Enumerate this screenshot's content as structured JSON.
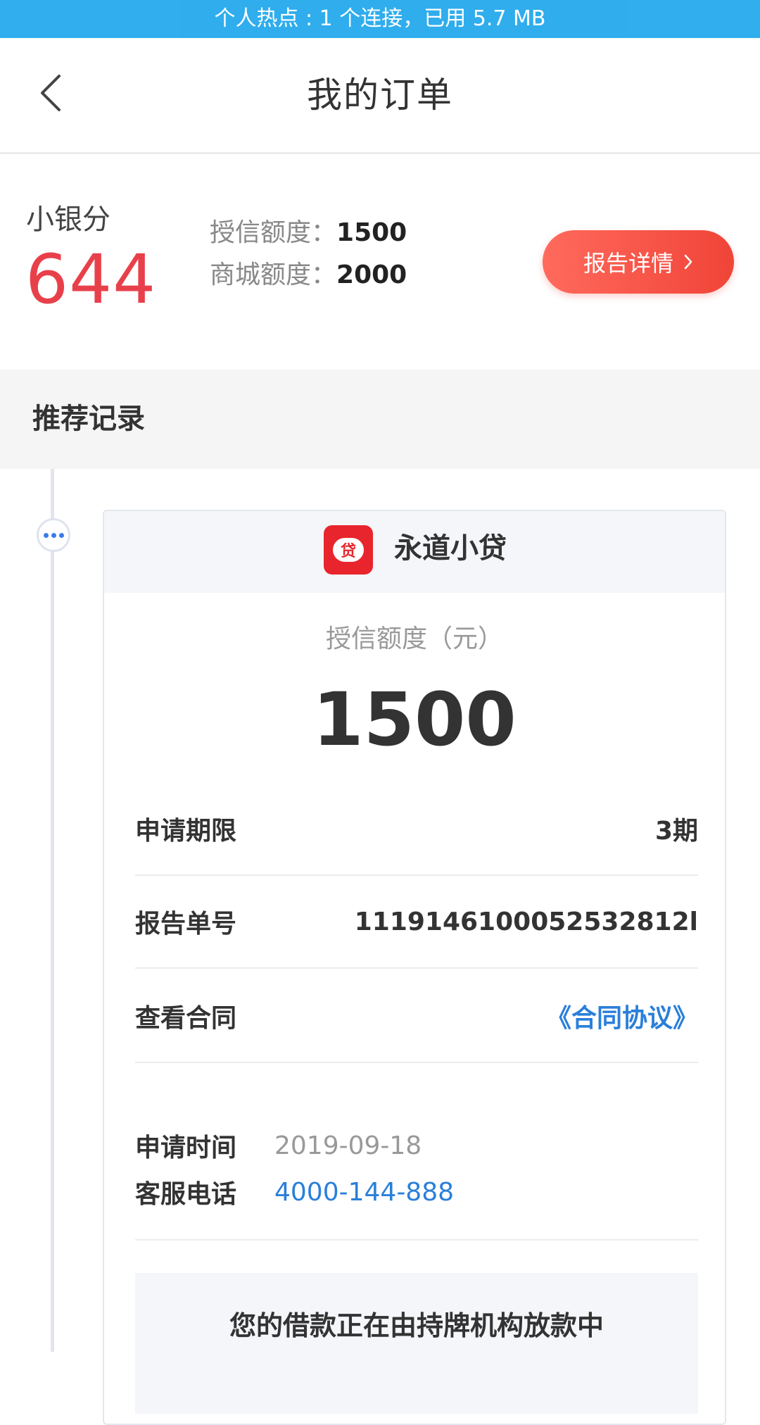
{
  "status_bar": {
    "text": "个人热点 : 1 个连接，已用 5.7 MB"
  },
  "nav": {
    "back_icon": "chevron-left-icon",
    "title": "我的订单"
  },
  "score": {
    "label": "小银分",
    "value": "644",
    "credit_label": "授信额度：",
    "credit_value": "1500",
    "mall_label": "商城额度：",
    "mall_value": "2000",
    "report_button": "报告详情",
    "report_icon": "chevron-right-icon"
  },
  "section": {
    "title": "推荐记录"
  },
  "colors": {
    "accent_red": "#e8404a",
    "link_blue": "#2a7fd9",
    "status_blue": "#1ea7ec"
  },
  "card": {
    "lender_logo_text": "贷",
    "lender_name": "永道小贷",
    "amount_label": "授信额度（元）",
    "amount_value": "1500",
    "rows": [
      {
        "key": "申请期限",
        "value": "3期"
      },
      {
        "key": "报告单号",
        "value": "1119146100052532812l"
      },
      {
        "key": "查看合同",
        "value": "《合同协议》"
      }
    ],
    "apply_time_label": "申请时间",
    "apply_time_value": "2019-09-18",
    "service_phone_label": "客服电话",
    "service_phone_value": "4000-144-888",
    "notice": "您的借款正在由持牌机构放款中"
  }
}
